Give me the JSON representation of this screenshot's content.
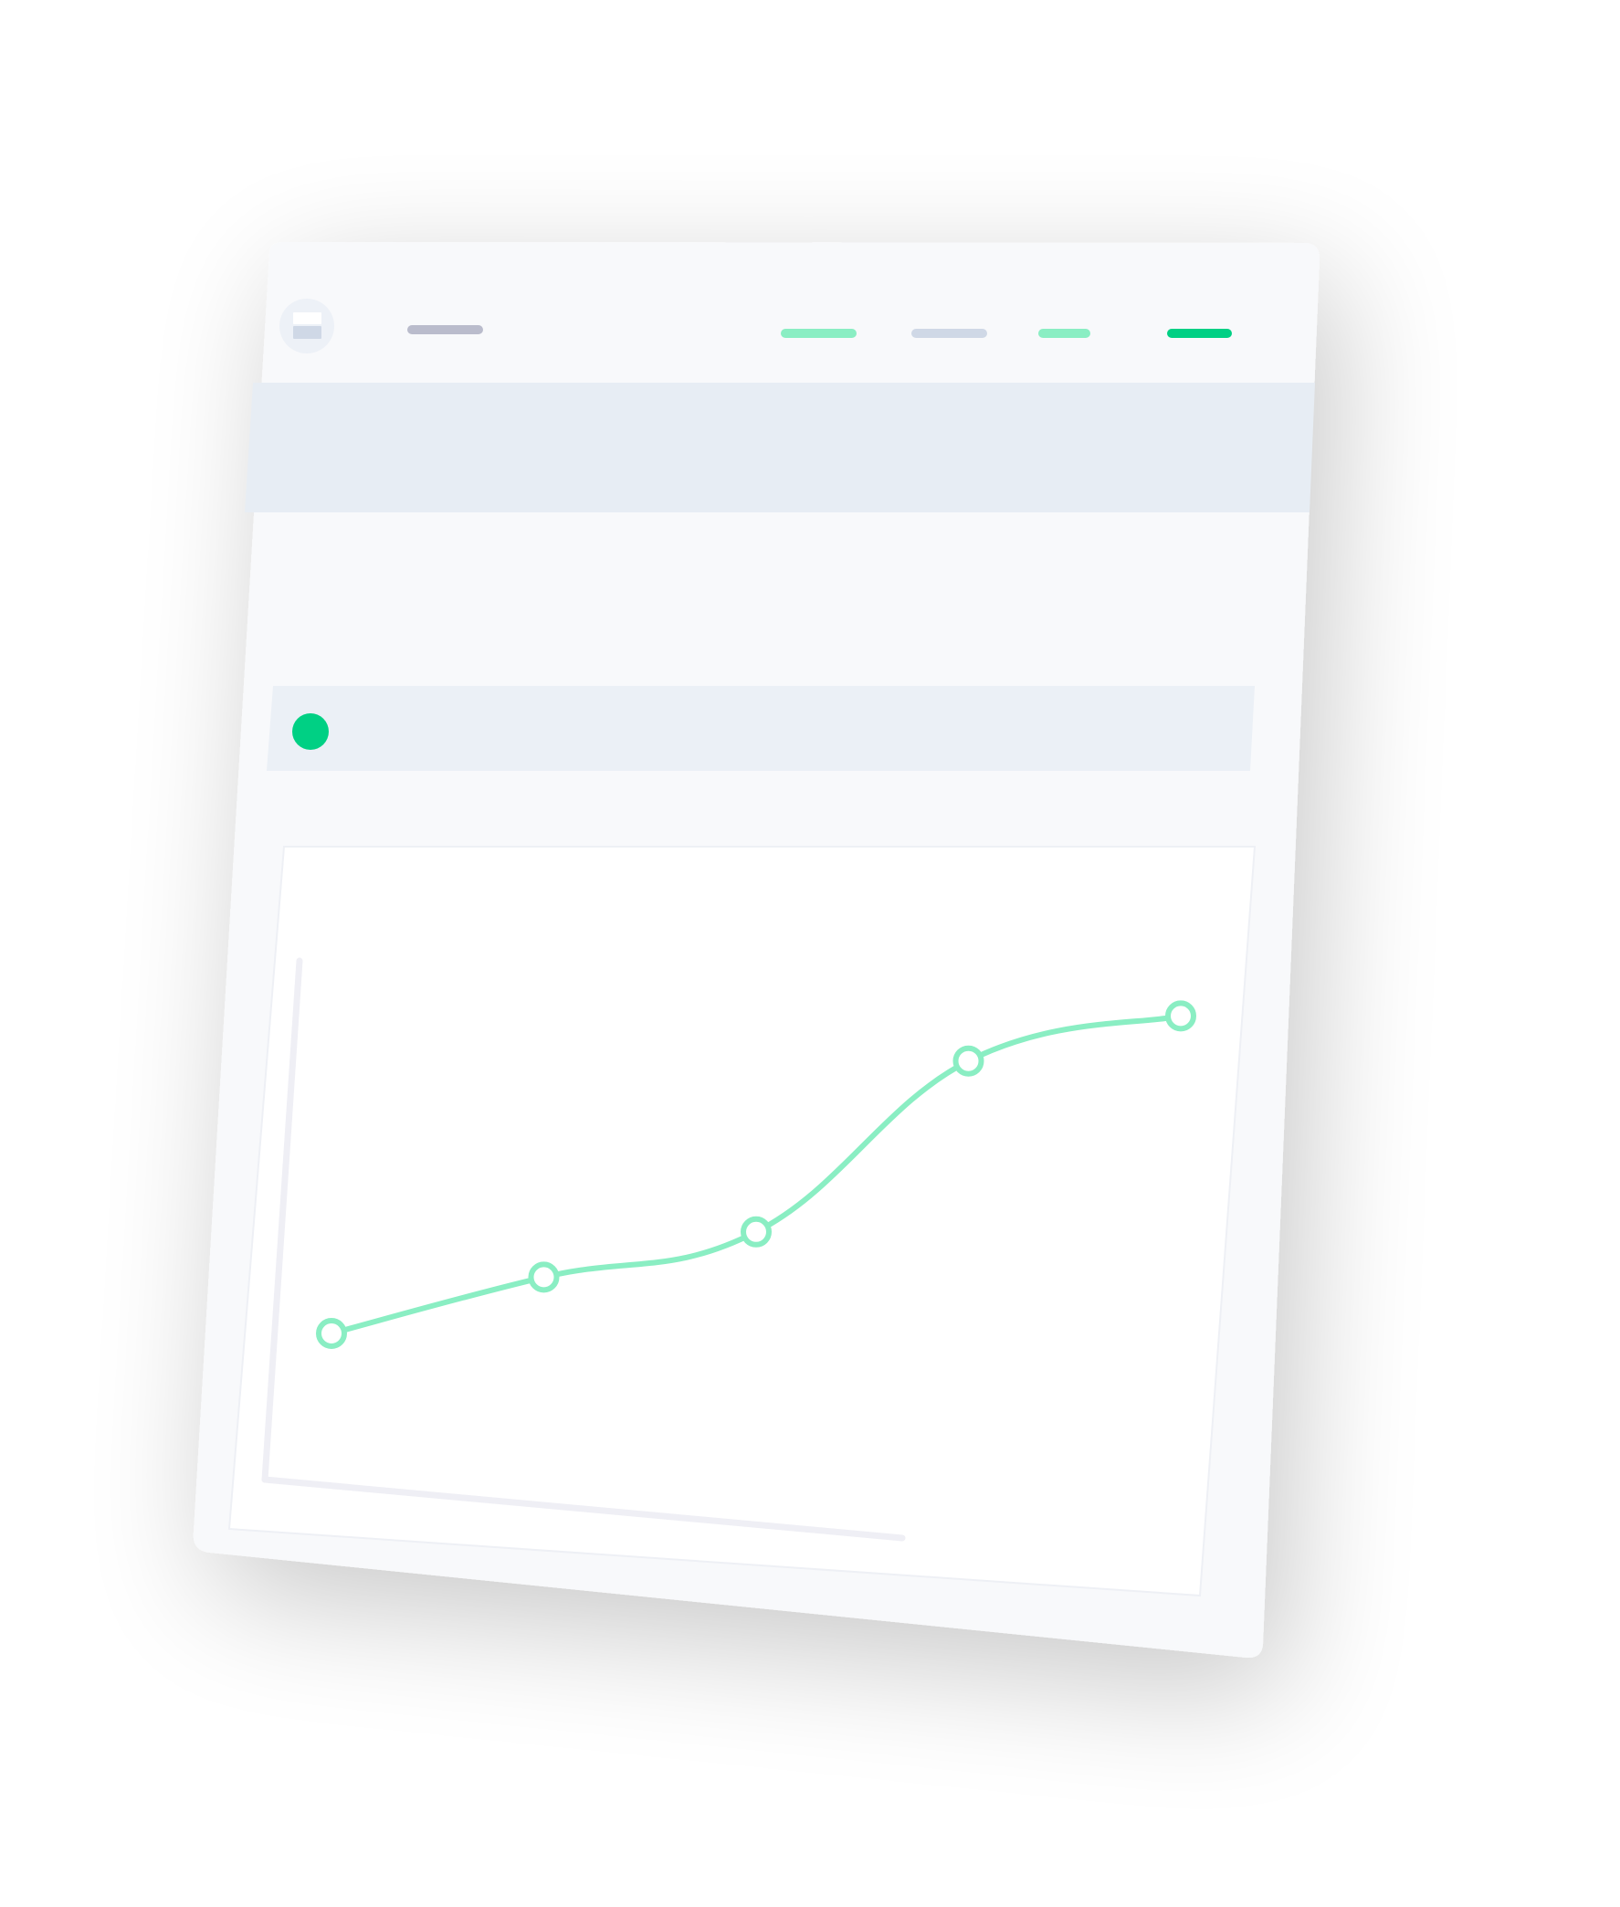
{
  "colors": {
    "background": "#ffffff",
    "window": "#f8f9fb",
    "banner": "#e7edf4",
    "panel": "#ebf0f6",
    "chart_bg": "#ffffff",
    "axis": "#efeff5",
    "accent": "#00d084",
    "accent_light": "#8aeec3",
    "nav_gray": "#cfd8e6",
    "title_gray": "#babccc",
    "logo_bg": "#edf1f7"
  },
  "header": {
    "logo_icon": "logo-icon",
    "nav_items": [
      {
        "name": "nav-item-1",
        "color": "#8aeec3"
      },
      {
        "name": "nav-item-2",
        "color": "#cfd8e6"
      },
      {
        "name": "nav-item-3",
        "color": "#8aeec3"
      },
      {
        "name": "nav-item-4",
        "color": "#00d084"
      }
    ]
  },
  "status": {
    "indicator_color": "#00d084"
  },
  "chart_data": {
    "type": "line",
    "title": "",
    "xlabel": "",
    "ylabel": "",
    "x": [
      1,
      2,
      3,
      4,
      5
    ],
    "series": [
      {
        "values": [
          1.0,
          2.1,
          3.0,
          6.2,
          7.1
        ],
        "color": "#8aeec3"
      }
    ],
    "ylim": [
      0,
      8
    ],
    "grid": false,
    "markers": "hollow-circle",
    "smooth": true
  }
}
